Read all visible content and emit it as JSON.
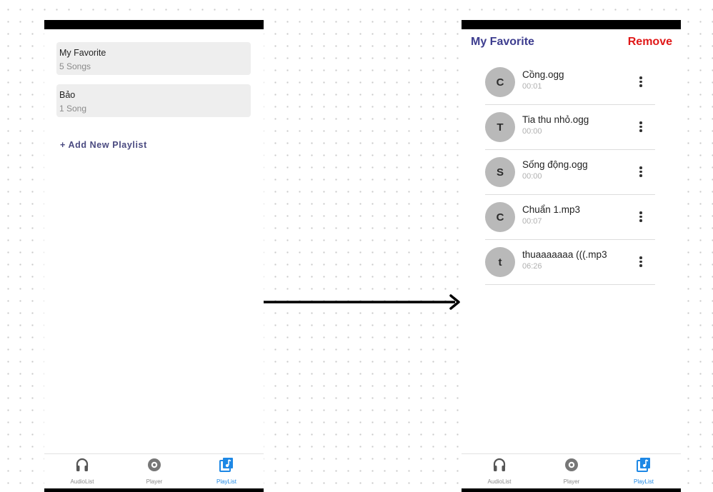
{
  "left_screen": {
    "playlists": [
      {
        "name": "My Favorite",
        "count": "5 Songs"
      },
      {
        "name": "Bảo",
        "count": "1 Song"
      }
    ],
    "add_playlist_label": "+ Add New Playlist"
  },
  "right_screen": {
    "title": "My Favorite",
    "remove_label": "Remove",
    "songs": [
      {
        "initial": "C",
        "title": "Cồng.ogg",
        "duration": "00:01"
      },
      {
        "initial": "T",
        "title": "Tia thu nhỏ.ogg",
        "duration": "00:00"
      },
      {
        "initial": "S",
        "title": "Sống động.ogg",
        "duration": "00:00"
      },
      {
        "initial": "C",
        "title": "Chuẩn 1.mp3",
        "duration": "00:07"
      },
      {
        "initial": "t",
        "title": "thuaaaaaaa (((.mp3",
        "duration": "06:26"
      }
    ]
  },
  "nav": {
    "items": [
      {
        "label": "AudioList",
        "icon": "headphones-icon"
      },
      {
        "label": "Player",
        "icon": "disc-icon"
      },
      {
        "label": "PlayList",
        "icon": "playlist-icon"
      }
    ],
    "active_index": 2
  },
  "colors": {
    "accent": "#3d3d8f",
    "remove": "#e01818",
    "nav_active": "#1e88e5",
    "card_bg": "#eeeeee",
    "avatar_bg": "#b9b9b9"
  }
}
